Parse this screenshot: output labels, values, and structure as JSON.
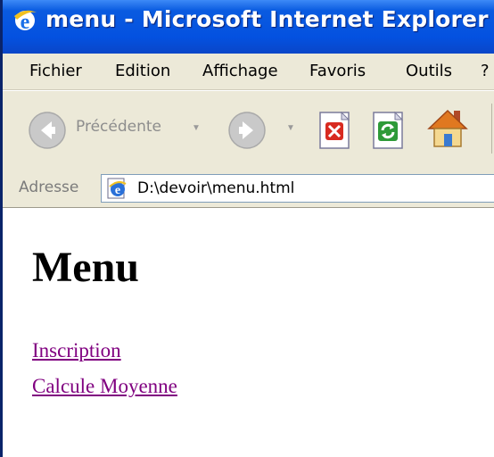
{
  "window": {
    "title": "menu - Microsoft Internet Explorer"
  },
  "menubar": {
    "items": [
      "Fichier",
      "Edition",
      "Affichage",
      "Favoris",
      "Outils",
      "?"
    ]
  },
  "toolbar": {
    "back_label": "Précédente",
    "icons": [
      "back-arrow-icon",
      "forward-arrow-icon",
      "stop-icon",
      "refresh-icon",
      "home-icon"
    ]
  },
  "address": {
    "label": "Adresse",
    "value": "D:\\devoir\\menu.html"
  },
  "page": {
    "heading": "Menu",
    "links": [
      "Inscription",
      "Calcule Moyenne"
    ]
  },
  "colors": {
    "titlebar": "#0451e0",
    "chrome": "#ece9d8",
    "visited_link": "#800080"
  }
}
